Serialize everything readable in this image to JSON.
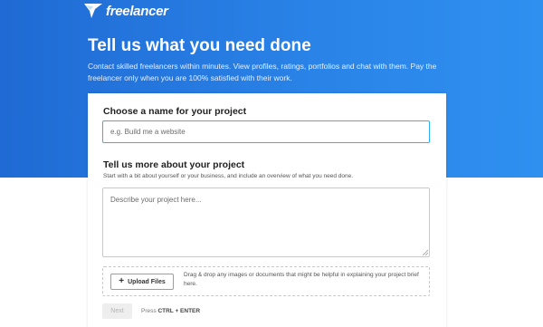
{
  "header": {
    "logo_text": "freelancer",
    "title": "Tell us what you need done",
    "subtitle": "Contact skilled freelancers within minutes. View profiles, ratings, portfolios and chat with them. Pay the freelancer only when you are 100% satisfied with their work."
  },
  "form": {
    "name_label": "Choose a name for your project",
    "name_placeholder": "e.g. Build me a website",
    "name_value": "",
    "desc_label": "Tell us more about your project",
    "desc_hint": "Start with a bit about yourself or your business, and include an overview of what you need done.",
    "desc_placeholder": "Describe your project here...",
    "desc_value": "",
    "upload_label": "Upload Files",
    "upload_text": "Drag & drop any images or documents that might be helpful in explaining your project brief here.",
    "next_label": "Next",
    "press_prefix": "Press",
    "press_keys": "CTRL + ENTER"
  },
  "colors": {
    "brand_blue": "#1f6ad4",
    "input_focus": "#29b2fe"
  }
}
